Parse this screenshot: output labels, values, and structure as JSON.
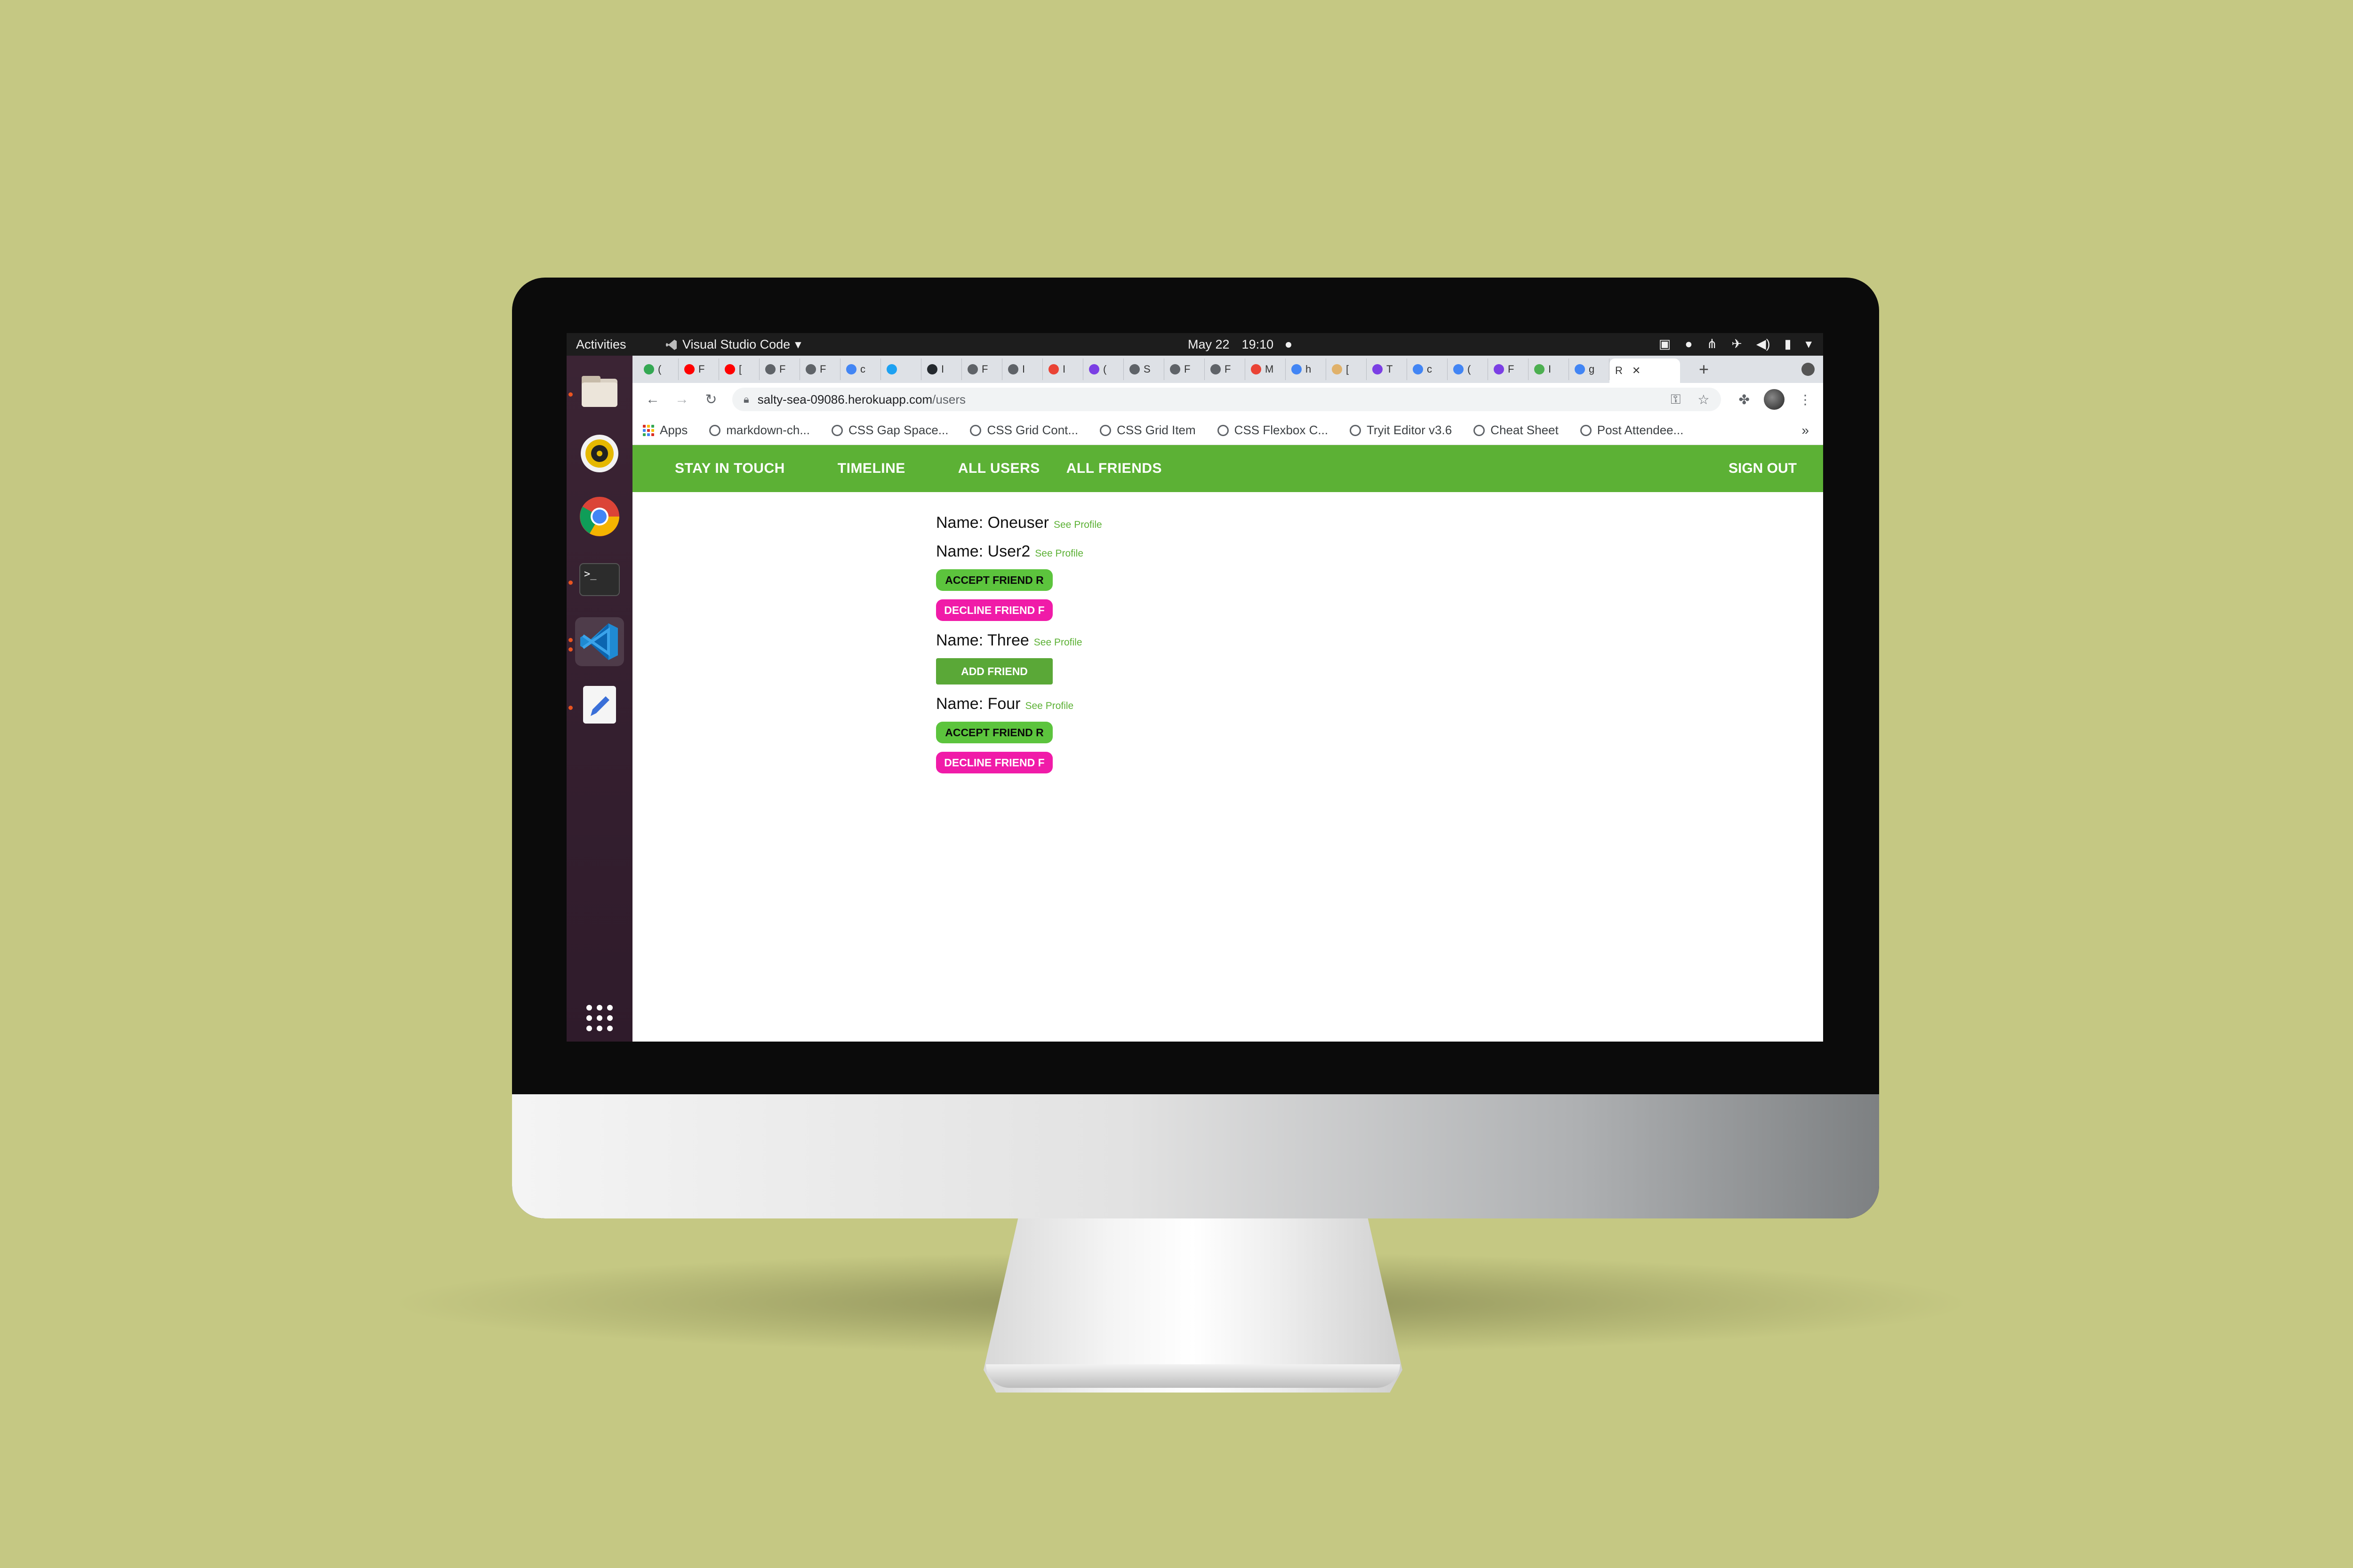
{
  "desktop": {
    "activities": "Activities",
    "active_app": "Visual Studio Code",
    "date": "May 22",
    "time": "19:10"
  },
  "dock": {
    "apps": [
      "files-icon",
      "rhythmbox-icon",
      "chrome-icon",
      "terminal-icon",
      "vscode-icon",
      "text-editor-icon",
      "show-apps-icon"
    ]
  },
  "browser": {
    "tabs": [
      "(",
      "F",
      "[",
      "F",
      "F",
      "c",
      "",
      "I",
      "F",
      "I",
      "I",
      "(",
      "S",
      "F",
      "F",
      "M",
      "h",
      "[",
      "T",
      "c",
      "(",
      "F",
      "I",
      "g"
    ],
    "current_tab": "R",
    "url_host": "salty-sea-09086.herokuapp.com",
    "url_path": "/users",
    "bookmarks": [
      "Apps",
      "markdown-ch...",
      "CSS Gap Space...",
      "CSS Grid Cont...",
      "CSS Grid Item",
      "CSS Flexbox C...",
      "Tryit Editor v3.6",
      "Cheat Sheet",
      "Post Attendee..."
    ],
    "bookmarks_more": "»"
  },
  "app": {
    "nav": {
      "brand": "STAY IN TOUCH",
      "timeline": "TIMELINE",
      "all_users": "ALL USERS",
      "all_friends": "ALL FRIENDS",
      "sign_out": "SIGN OUT"
    },
    "see_profile": "See Profile",
    "users": [
      {
        "name": "Name: Oneuser"
      },
      {
        "name": "Name: User2",
        "accept": "ACCEPT FRIEND R",
        "decline": "DECLINE FRIEND F"
      },
      {
        "name": "Name: Three",
        "add": "ADD FRIEND"
      },
      {
        "name": "Name: Four",
        "accept": "ACCEPT FRIEND R",
        "decline": "DECLINE FRIEND F"
      }
    ]
  },
  "colors": {
    "background": "#c5c883",
    "nav_green": "#5cb135",
    "accept_green": "#5cc43d",
    "decline_pink": "#f01ba8"
  }
}
